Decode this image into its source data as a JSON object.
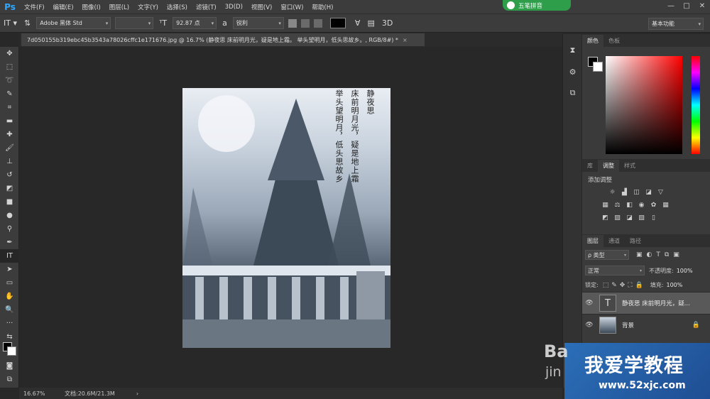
{
  "app": {
    "logo": "Ps"
  },
  "menu": [
    "文件(F)",
    "编辑(E)",
    "图像(I)",
    "图层(L)",
    "文字(Y)",
    "选择(S)",
    "滤镜(T)",
    "3D(D)",
    "视图(V)",
    "窗口(W)",
    "帮助(H)"
  ],
  "ime": {
    "label": "五笔拼音"
  },
  "options": {
    "font_family": "Adobe 黑体 Std",
    "font_size": "92.87 点",
    "aa_size_label": "a",
    "antialias": "锐利",
    "workspace": "基本功能",
    "three_d_label": "3D",
    "text_color": "#000000"
  },
  "document": {
    "tab_title": "7d050155b319ebc45b3543a78026cffc1e171676.jpg @ 16.7% (静夜思  床前明月光，疑是地上霜。 举头望明月，低头思故乡。, RGB/8#) *",
    "close": "×"
  },
  "poem": {
    "title": "静夜思",
    "line1": "床前明月光，疑是地上霜",
    "line2": "举头望明月，低头思故乡"
  },
  "status": {
    "zoom": "16.67%",
    "doc_info": "文档:20.6M/21.3M",
    "arrow": "›"
  },
  "panels": {
    "color_tabs": [
      "颜色",
      "色板"
    ],
    "adjust_tabs": [
      "库",
      "调整",
      "样式"
    ],
    "adjust_title": "添加调整",
    "layer_tabs": [
      "图层",
      "通道",
      "路径"
    ],
    "filter_kind": "ρ 类型",
    "blend_mode": "正常",
    "opacity_label": "不透明度:",
    "opacity_value": "100%",
    "lock_label": "锁定:",
    "fill_label": "填充:",
    "fill_value": "100%",
    "layers": [
      {
        "name": "静夜思 床前明月光，疑...",
        "thumb": "T",
        "selected": true
      },
      {
        "name": "背景",
        "thumb": "",
        "selected": false
      }
    ]
  },
  "watermark": {
    "main": "我爱学教程",
    "url": "www.52xjc.com",
    "overlay1": "Ba",
    "overlay2": "jin"
  }
}
